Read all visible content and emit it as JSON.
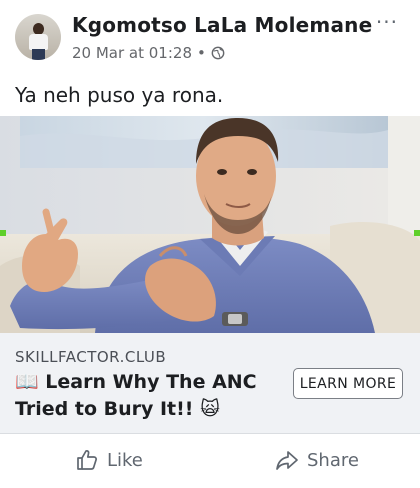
{
  "post": {
    "author": "Kgomotso LaLa Molemane",
    "timestamp": "20 Mar at 01:28",
    "separator": "•",
    "privacy_icon": "globe-icon",
    "more_label": "···",
    "text": "Ya neh puso ya rona."
  },
  "link": {
    "domain": "SKILLFACTOR.CLUB",
    "headline": "📖 Learn Why The ANC Tried to Bury It!! 🙀",
    "cta_label": "LEARN MORE"
  },
  "actions": {
    "like_label": "Like",
    "share_label": "Share"
  },
  "colors": {
    "secondary_text": "#65676b",
    "link_card_bg": "#f0f2f5",
    "cta_border": "#7b7f86",
    "selection_handle": "#5fcf2a"
  }
}
